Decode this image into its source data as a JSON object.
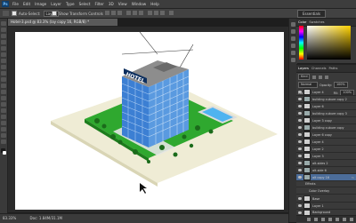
{
  "app": {
    "logo": "Ps"
  },
  "menu": [
    "File",
    "Edit",
    "Image",
    "Layer",
    "Type",
    "Select",
    "Filter",
    "3D",
    "View",
    "Window",
    "Help"
  ],
  "options": {
    "auto_select": "Auto-Select:",
    "target": "Layer",
    "show_transform": "Show Transform Controls",
    "workspace": "Essentials"
  },
  "document": {
    "tab_title": "Hotel-3.psd @ 83.3% (lay copy 16, RGB/8) *"
  },
  "status": {
    "zoom": "83.33%",
    "doc_size": "Doc: 1.84M/31.1M"
  },
  "color_panel": {
    "tabs": [
      "Color",
      "Swatches"
    ]
  },
  "layers_panel": {
    "tabs": [
      "Layers",
      "Channels",
      "Paths"
    ],
    "kind": "Kind",
    "blend": "Normal",
    "opacity_label": "Opacity:",
    "opacity": "100%",
    "fill_label": "Fill:",
    "fill": "100%",
    "lock_label": "Lock:"
  },
  "layers": [
    {
      "name": "Layer 4"
    },
    {
      "name": "building cubure copy 2"
    },
    {
      "name": "Layer 6"
    },
    {
      "name": "building cubure copy 3"
    },
    {
      "name": "Layer 3 copy"
    },
    {
      "name": "building cubure copy"
    },
    {
      "name": "Layer 6 copy"
    },
    {
      "name": "Layer 4"
    },
    {
      "name": "Layer 2"
    },
    {
      "name": "Layer 3"
    },
    {
      "name": "alt-sides 2"
    },
    {
      "name": "alt-side 6"
    },
    {
      "name": "alt copy 16"
    },
    {
      "name": "Effects"
    },
    {
      "name": "Color Overlay"
    },
    {
      "name": "Base"
    },
    {
      "name": "Layer 1"
    },
    {
      "name": "Background"
    }
  ],
  "scene": {
    "sign": "HOTEL"
  }
}
